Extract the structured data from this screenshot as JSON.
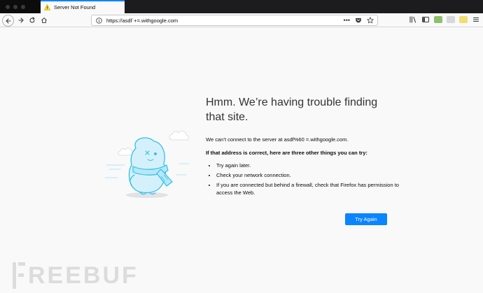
{
  "tab": {
    "title": "Server Not Found",
    "icon": "warning-icon"
  },
  "navbar": {
    "url": "https://asdf`+=.withgoogle.com",
    "more_label": "•••",
    "icons": [
      "back-icon",
      "forward-icon",
      "reload-icon",
      "home-icon",
      "info-icon",
      "pocket-icon",
      "bookmark-star-icon",
      "library-icon",
      "sidebar-icon",
      "menu-icon"
    ]
  },
  "error": {
    "title": "Hmm. We’re having trouble finding that site.",
    "description": "We can’t connect to the server at asdf%60 =.withgoogle.com.",
    "tips_heading": "If that address is correct, here are three other things you can try:",
    "tips": [
      "Try again later.",
      "Check your network connection.",
      "If you are connected but behind a firewall, check that Firefox has permission to access the Web."
    ],
    "button_label": "Try Again"
  },
  "watermark": {
    "text": "REEBUF"
  },
  "colors": {
    "accent": "#0a84ff",
    "page_bg": "#f9f9fa",
    "tabstrip_bg": "#0c0c0d",
    "warning": "#ffe900",
    "watermark": "#dcdcde"
  }
}
